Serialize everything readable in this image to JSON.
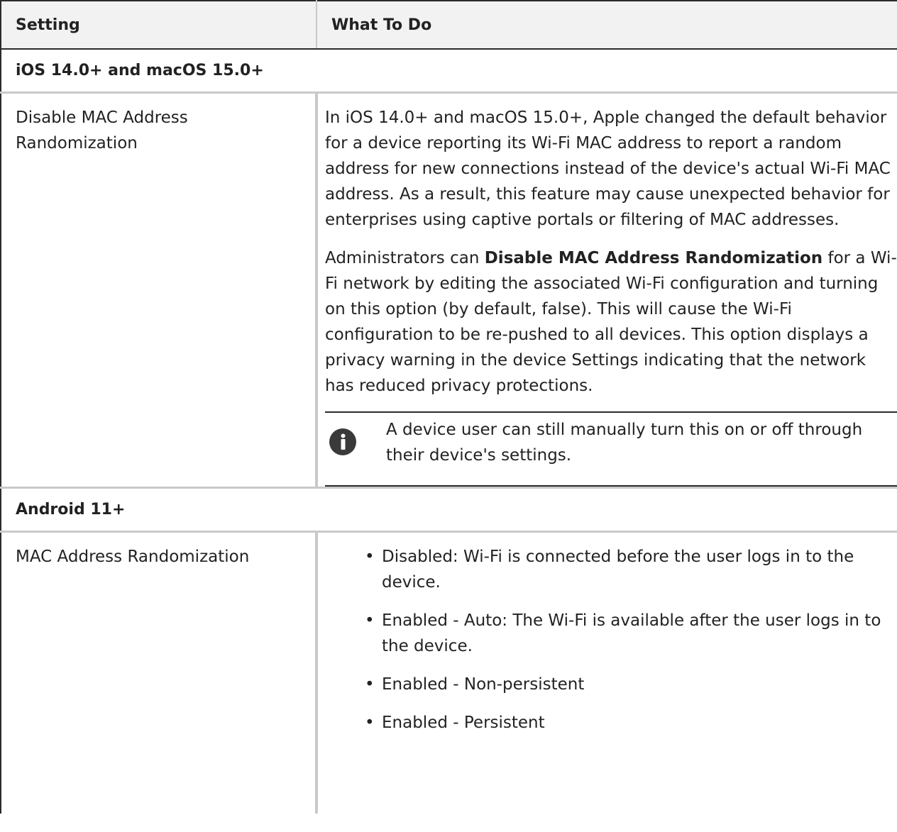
{
  "header": {
    "setting": "Setting",
    "what_to_do": "What To Do"
  },
  "sections": [
    {
      "title": "iOS 14.0+ and macOS 15.0+",
      "setting": "Disable MAC Address Randomization",
      "paragraph1": "In iOS 14.0+ and macOS 15.0+, Apple changed the default behavior for a device reporting its Wi-Fi MAC address to report a random address for new connections instead of the device's actual Wi-Fi MAC address. As a result, this feature may cause unexpected behavior for enterprises using captive portals or filtering of MAC addresses.",
      "paragraph2_prefix": "Administrators can ",
      "paragraph2_bold": "Disable MAC Address Randomization",
      "paragraph2_suffix": " for a Wi-Fi network by editing the associated Wi-Fi configuration and turning on this option (by default, false). This will cause the Wi-Fi configuration to be re-pushed to all devices. This option displays a privacy warning in the device Settings indicating that the network has reduced privacy protections.",
      "note": "A device user can still manually turn this on or off through their device's settings.",
      "note_icon": "info-icon"
    },
    {
      "title": "Android 11+",
      "setting": "MAC Address Randomization",
      "bullets": [
        "Disabled: Wi-Fi is connected before the user logs in to the device.",
        "Enabled - Auto: The Wi-Fi is available after the user logs in to the device.",
        "Enabled - Non-persistent",
        "Enabled - Persistent"
      ]
    }
  ],
  "colors": {
    "border_dark": "#2b2b2b",
    "border_light": "#c9c9c9",
    "header_bg": "#f2f2f2",
    "text": "#222222",
    "icon_bg": "#3a3a3a"
  }
}
